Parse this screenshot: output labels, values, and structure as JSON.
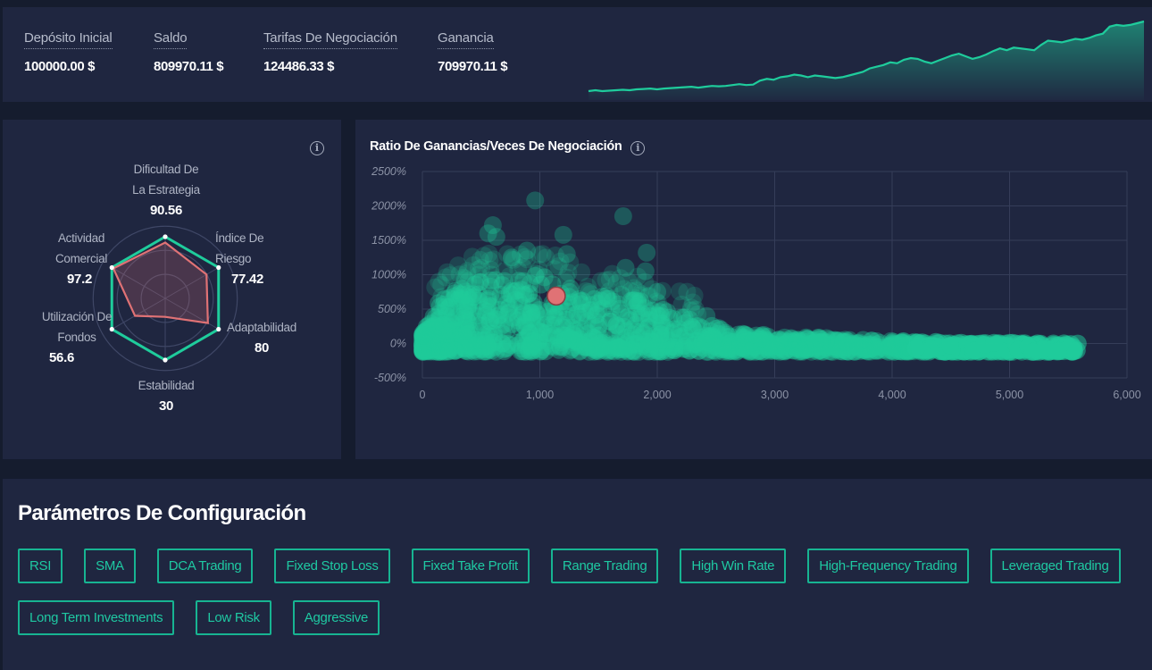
{
  "stats": [
    {
      "label": "Depósito Inicial",
      "value": "100000.00 $"
    },
    {
      "label": "Saldo",
      "value": "809970.11 $"
    },
    {
      "label": "Tarifas De Negociación",
      "value": "124486.33 $"
    },
    {
      "label": "Ganancia",
      "value": "709970.11 $"
    }
  ],
  "colors": {
    "accent": "#1fcc9c",
    "highlight": "#e07275",
    "panel": "#1f2640",
    "background": "#151c2e"
  },
  "icons": {
    "info": "i"
  },
  "chart_data": [
    {
      "type": "area",
      "name": "balance-sparkline",
      "title": "",
      "series": [
        {
          "name": "Saldo",
          "values": [
            100,
            101,
            100,
            100.5,
            101,
            101.5,
            101,
            102,
            102.5,
            103,
            102,
            103,
            103.5,
            104,
            104.5,
            105,
            104,
            105,
            106,
            105.5,
            106,
            107,
            108,
            107,
            107.5,
            112,
            114,
            113,
            116,
            117,
            119,
            118,
            116,
            118,
            117,
            116,
            115,
            116,
            118,
            120,
            122,
            126,
            128,
            130,
            133,
            132,
            136,
            138,
            137,
            134,
            132,
            135,
            138,
            141,
            143,
            140,
            137,
            139,
            142,
            146,
            149,
            147,
            150,
            149,
            148,
            147,
            153,
            158,
            157,
            156,
            158,
            160,
            159,
            161,
            164,
            166,
            174,
            176,
            175,
            176,
            178,
            180
          ]
        }
      ],
      "xlabel": "",
      "ylabel": ""
    },
    {
      "type": "radar",
      "name": "strategy-radar",
      "axes": [
        {
          "label": "Dificultad De La Estrategia",
          "value": 90.56
        },
        {
          "label": "Índice De Riesgo",
          "value": 77.42
        },
        {
          "label": "Adaptabilidad",
          "value": 80
        },
        {
          "label": "Estabilidad",
          "value": 30
        },
        {
          "label": "Utilización De Fondos",
          "value": 56.6
        },
        {
          "label": "Actividad Comercial",
          "value": 97.2
        }
      ],
      "max": 100,
      "rings": 3
    },
    {
      "type": "scatter",
      "name": "profit-ratio-vs-trades",
      "title": "Ratio De Ganancias/Veces De Negociación",
      "xlabel": "",
      "ylabel": "",
      "xlim": [
        0,
        6000
      ],
      "ylim": [
        -500,
        2500
      ],
      "xticks": [
        "0",
        "1,000",
        "2,000",
        "3,000",
        "4,000",
        "5,000",
        "6,000"
      ],
      "yticks": [
        "-500%",
        "0%",
        "500%",
        "1000%",
        "1500%",
        "2000%",
        "2500%"
      ],
      "grid": true,
      "highlight_point": {
        "x": 1140,
        "y": 690
      },
      "outliers": [
        {
          "x": 960,
          "y": 2080
        },
        {
          "x": 1710,
          "y": 1850
        },
        {
          "x": 600,
          "y": 1720
        },
        {
          "x": 1200,
          "y": 1580
        },
        {
          "x": 1230,
          "y": 1300
        },
        {
          "x": 1910,
          "y": 1320
        },
        {
          "x": 630,
          "y": 1550
        },
        {
          "x": 560,
          "y": 1600
        },
        {
          "x": 760,
          "y": 1250
        },
        {
          "x": 890,
          "y": 1350
        },
        {
          "x": 1730,
          "y": 1100
        },
        {
          "x": 1900,
          "y": 1050
        },
        {
          "x": 2000,
          "y": 750
        },
        {
          "x": 2420,
          "y": 400
        }
      ],
      "cloud_envelope": [
        {
          "x": 0,
          "y": 150
        },
        {
          "x": 100,
          "y": 500
        },
        {
          "x": 200,
          "y": 750
        },
        {
          "x": 400,
          "y": 900
        },
        {
          "x": 600,
          "y": 1000
        },
        {
          "x": 800,
          "y": 950
        },
        {
          "x": 1000,
          "y": 1000
        },
        {
          "x": 1200,
          "y": 900
        },
        {
          "x": 1400,
          "y": 700
        },
        {
          "x": 1600,
          "y": 700
        },
        {
          "x": 1800,
          "y": 650
        },
        {
          "x": 2000,
          "y": 550
        },
        {
          "x": 2200,
          "y": 450
        },
        {
          "x": 2400,
          "y": 300
        },
        {
          "x": 2700,
          "y": 150
        },
        {
          "x": 3000,
          "y": 120
        },
        {
          "x": 3500,
          "y": 80
        },
        {
          "x": 4000,
          "y": 40
        },
        {
          "x": 4500,
          "y": 20
        },
        {
          "x": 5000,
          "y": 10
        },
        {
          "x": 5580,
          "y": 0
        }
      ],
      "cloud_floor": -120
    }
  ],
  "params": {
    "title": "Parámetros De Configuración",
    "tags": [
      "RSI",
      "SMA",
      "DCA Trading",
      "Fixed Stop Loss",
      "Fixed Take Profit",
      "Range Trading",
      "High Win Rate",
      "High-Frequency Trading",
      "Leveraged Trading",
      "Long Term Investments",
      "Low Risk",
      "Aggressive"
    ]
  }
}
